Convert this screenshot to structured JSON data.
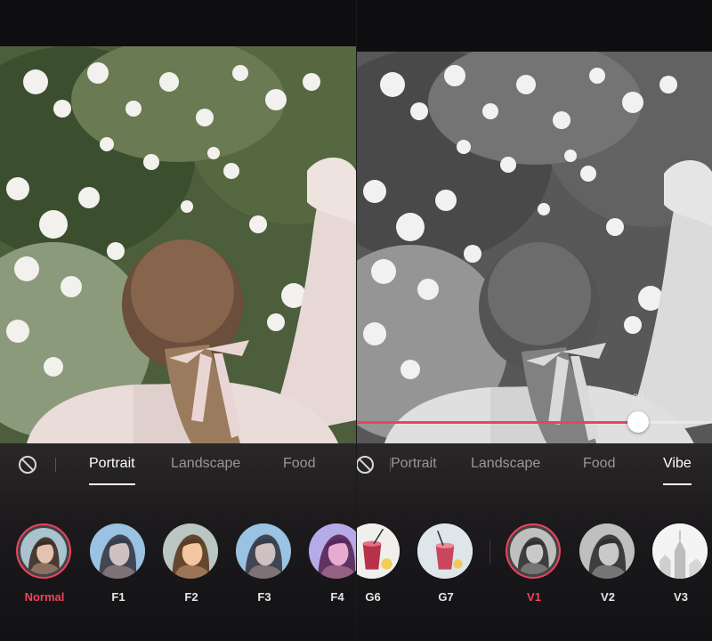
{
  "left_panel": {
    "tabs": [
      {
        "label": "Portrait",
        "active": true
      },
      {
        "label": "Landscape",
        "active": false
      },
      {
        "label": "Food",
        "active": false
      }
    ],
    "filters": [
      {
        "label": "Normal",
        "selected": true
      },
      {
        "label": "F1",
        "selected": false
      },
      {
        "label": "F2",
        "selected": false
      },
      {
        "label": "F3",
        "selected": false
      },
      {
        "label": "F4",
        "selected": false
      }
    ]
  },
  "right_panel": {
    "tabs": [
      {
        "label": "Portrait",
        "active": false
      },
      {
        "label": "Landscape",
        "active": false
      },
      {
        "label": "Food",
        "active": false
      },
      {
        "label": "Vibe",
        "active": true
      }
    ],
    "filters": [
      {
        "label": "G6",
        "selected": false
      },
      {
        "label": "G7",
        "selected": false
      },
      {
        "label": "V1",
        "selected": true
      },
      {
        "label": "V2",
        "selected": false
      },
      {
        "label": "V3",
        "selected": false
      }
    ],
    "slider": {
      "value": "80",
      "fraction": 0.79
    }
  },
  "colors": {
    "accent": "#f0425f",
    "background": "#0f0e10",
    "inactive_text": "#9a9699"
  },
  "icons": {
    "no_filter": "no-filter-icon"
  }
}
